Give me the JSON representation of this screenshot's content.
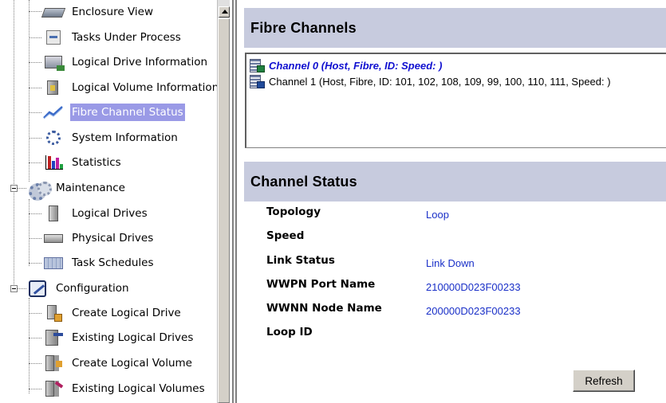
{
  "tree": {
    "items": [
      {
        "label": "Enclosure View",
        "icon": "enclosure-icon"
      },
      {
        "label": "Tasks Under Process",
        "icon": "tasks-icon"
      },
      {
        "label": "Logical Drive Information",
        "icon": "logical-drive-info-icon"
      },
      {
        "label": "Logical Volume Information",
        "icon": "logical-volume-info-icon"
      },
      {
        "label": "Fibre Channel Status",
        "icon": "fibre-channel-icon",
        "selected": true
      },
      {
        "label": "System Information",
        "icon": "system-info-icon"
      },
      {
        "label": "Statistics",
        "icon": "statistics-icon"
      },
      {
        "label": "Maintenance",
        "icon": "maintenance-icon"
      },
      {
        "label": "Logical Drives",
        "icon": "logical-drive-icon"
      },
      {
        "label": "Physical Drives",
        "icon": "physical-drive-icon"
      },
      {
        "label": "Task Schedules",
        "icon": "task-schedule-icon"
      },
      {
        "label": "Configuration",
        "icon": "configuration-icon"
      },
      {
        "label": "Create Logical Drive",
        "icon": "create-logical-drive-icon"
      },
      {
        "label": "Existing Logical Drives",
        "icon": "existing-logical-drives-icon"
      },
      {
        "label": "Create Logical Volume",
        "icon": "create-logical-volume-icon"
      },
      {
        "label": "Existing Logical Volumes",
        "icon": "existing-logical-volumes-icon"
      }
    ],
    "selection_color": "#9a9ae6"
  },
  "fibre_channels": {
    "title": "Fibre Channels",
    "channels": [
      {
        "label": "Channel 0 (Host, Fibre, ID: Speed: )",
        "active": true
      },
      {
        "label": "Channel 1 (Host, Fibre, ID: 101, 102, 108, 109, 99, 100, 110, 111, Speed: )",
        "active": false
      }
    ]
  },
  "channel_status": {
    "title": "Channel Status",
    "rows": [
      {
        "label": "Topology",
        "value": "Loop"
      },
      {
        "label": "Speed",
        "value": ""
      },
      {
        "label": "Link Status",
        "value": "Link Down"
      },
      {
        "label": "WWPN Port Name",
        "value": "210000D023F00233"
      },
      {
        "label": "WWNN Node Name",
        "value": "200000D023F00233"
      },
      {
        "label": "Loop ID",
        "value": ""
      }
    ],
    "refresh_label": "Refresh"
  },
  "colors": {
    "header_bg": "#c7cbde",
    "value_text": "#1a30c8",
    "active_channel_text": "#1010d0"
  }
}
